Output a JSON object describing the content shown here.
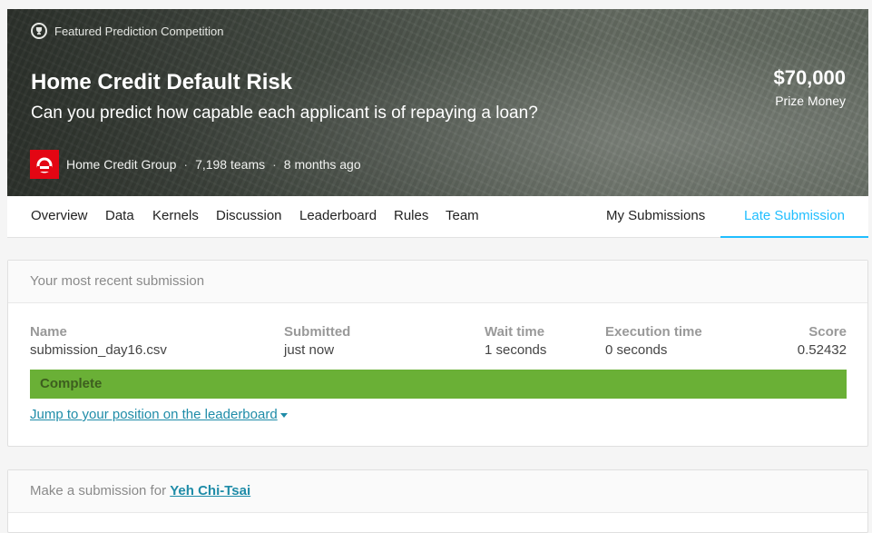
{
  "banner": {
    "featured_label": "Featured Prediction Competition",
    "title": "Home Credit Default Risk",
    "subtitle": "Can you predict how capable each applicant is of repaying a loan?",
    "prize_amount": "$70,000",
    "prize_label": "Prize Money",
    "host_name": "Home Credit Group",
    "separator": "·",
    "teams": "7,198 teams",
    "time_ago": "8 months ago",
    "host_logo_color": "#e30613"
  },
  "nav": {
    "tabs": [
      "Overview",
      "Data",
      "Kernels",
      "Discussion",
      "Leaderboard",
      "Rules",
      "Team"
    ],
    "my_submissions": "My Submissions",
    "late_submission": "Late Submission",
    "active_color": "#20beff"
  },
  "recent": {
    "header": "Your most recent submission",
    "columns": {
      "name": {
        "label": "Name",
        "value": "submission_day16.csv"
      },
      "submitted": {
        "label": "Submitted",
        "value": "just now"
      },
      "wait": {
        "label": "Wait time",
        "value": "1 seconds"
      },
      "execution": {
        "label": "Execution time",
        "value": "0 seconds"
      },
      "score": {
        "label": "Score",
        "value": "0.52432"
      }
    },
    "status": "Complete",
    "status_color": "#6ab036",
    "jump_link": "Jump to your position on the leaderboard"
  },
  "make_submission": {
    "prefix": "Make a submission for",
    "user": "Yeh Chi-Tsai"
  }
}
